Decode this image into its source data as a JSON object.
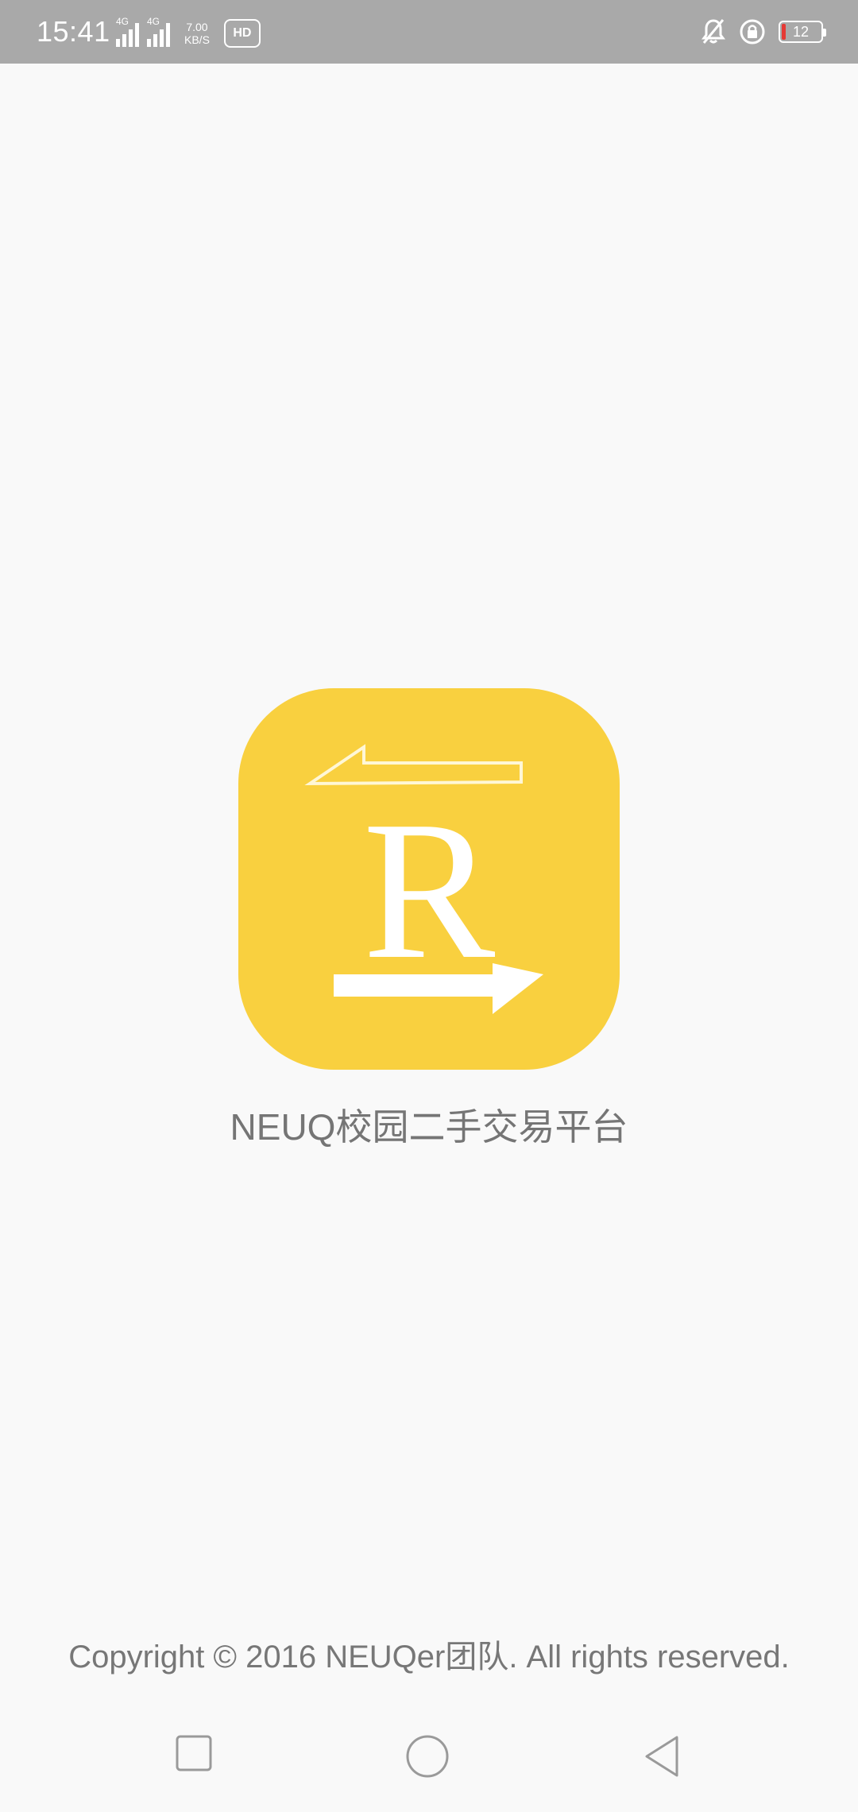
{
  "status_bar": {
    "time": "15:41",
    "signal1_tag": "4G",
    "signal2_tag": "4G",
    "net_speed_value": "7.00",
    "net_speed_unit": "KB/S",
    "hd_label": "HD",
    "battery_level": "12",
    "icons": [
      "mute-bell-icon",
      "rotation-lock-icon",
      "battery-icon"
    ]
  },
  "app": {
    "name": "NEUQ校园二手交易平台",
    "icon_letter": "R",
    "icon_color": "#f9d03f"
  },
  "footer": {
    "copyright": "Copyright © 2016 NEUQer团队. All rights reserved."
  },
  "nav_bar": {
    "buttons": [
      "recent-apps",
      "home",
      "back"
    ]
  }
}
